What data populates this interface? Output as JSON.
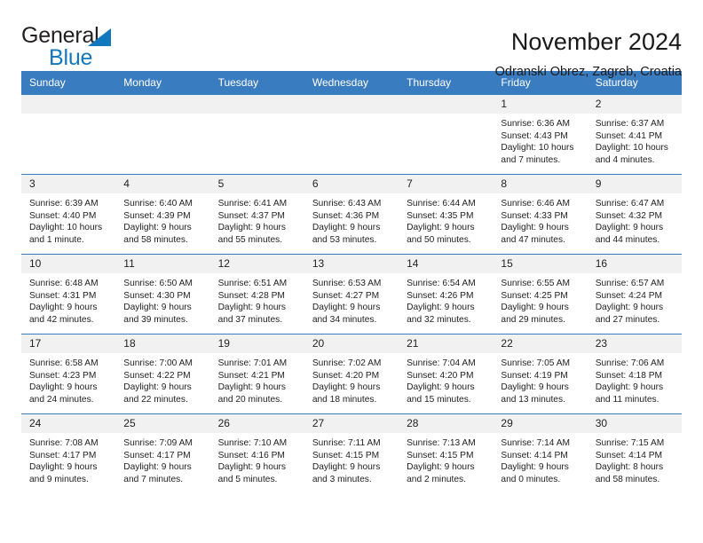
{
  "brand": {
    "word_one": "General",
    "word_two": "Blue",
    "triangle_color": "#1278be"
  },
  "header": {
    "title": "November 2024",
    "subtitle": "Odranski Obrez, Zagreb, Croatia",
    "accent_color": "#3a7cc0",
    "daynum_bg": "#f1f1f1"
  },
  "weekday_headers": [
    "Sunday",
    "Monday",
    "Tuesday",
    "Wednesday",
    "Thursday",
    "Friday",
    "Saturday"
  ],
  "labels": {
    "sunrise": "Sunrise:",
    "sunset": "Sunset:",
    "daylight": "Daylight:"
  },
  "weeks": [
    [
      {
        "day": "",
        "empty": true
      },
      {
        "day": "",
        "empty": true
      },
      {
        "day": "",
        "empty": true
      },
      {
        "day": "",
        "empty": true
      },
      {
        "day": "",
        "empty": true
      },
      {
        "day": "1",
        "sunrise": "Sunrise: 6:36 AM",
        "sunset": "Sunset: 4:43 PM",
        "daylight_1": "Daylight: 10 hours",
        "daylight_2": "and 7 minutes."
      },
      {
        "day": "2",
        "sunrise": "Sunrise: 6:37 AM",
        "sunset": "Sunset: 4:41 PM",
        "daylight_1": "Daylight: 10 hours",
        "daylight_2": "and 4 minutes."
      }
    ],
    [
      {
        "day": "3",
        "sunrise": "Sunrise: 6:39 AM",
        "sunset": "Sunset: 4:40 PM",
        "daylight_1": "Daylight: 10 hours",
        "daylight_2": "and 1 minute."
      },
      {
        "day": "4",
        "sunrise": "Sunrise: 6:40 AM",
        "sunset": "Sunset: 4:39 PM",
        "daylight_1": "Daylight: 9 hours",
        "daylight_2": "and 58 minutes."
      },
      {
        "day": "5",
        "sunrise": "Sunrise: 6:41 AM",
        "sunset": "Sunset: 4:37 PM",
        "daylight_1": "Daylight: 9 hours",
        "daylight_2": "and 55 minutes."
      },
      {
        "day": "6",
        "sunrise": "Sunrise: 6:43 AM",
        "sunset": "Sunset: 4:36 PM",
        "daylight_1": "Daylight: 9 hours",
        "daylight_2": "and 53 minutes."
      },
      {
        "day": "7",
        "sunrise": "Sunrise: 6:44 AM",
        "sunset": "Sunset: 4:35 PM",
        "daylight_1": "Daylight: 9 hours",
        "daylight_2": "and 50 minutes."
      },
      {
        "day": "8",
        "sunrise": "Sunrise: 6:46 AM",
        "sunset": "Sunset: 4:33 PM",
        "daylight_1": "Daylight: 9 hours",
        "daylight_2": "and 47 minutes."
      },
      {
        "day": "9",
        "sunrise": "Sunrise: 6:47 AM",
        "sunset": "Sunset: 4:32 PM",
        "daylight_1": "Daylight: 9 hours",
        "daylight_2": "and 44 minutes."
      }
    ],
    [
      {
        "day": "10",
        "sunrise": "Sunrise: 6:48 AM",
        "sunset": "Sunset: 4:31 PM",
        "daylight_1": "Daylight: 9 hours",
        "daylight_2": "and 42 minutes."
      },
      {
        "day": "11",
        "sunrise": "Sunrise: 6:50 AM",
        "sunset": "Sunset: 4:30 PM",
        "daylight_1": "Daylight: 9 hours",
        "daylight_2": "and 39 minutes."
      },
      {
        "day": "12",
        "sunrise": "Sunrise: 6:51 AM",
        "sunset": "Sunset: 4:28 PM",
        "daylight_1": "Daylight: 9 hours",
        "daylight_2": "and 37 minutes."
      },
      {
        "day": "13",
        "sunrise": "Sunrise: 6:53 AM",
        "sunset": "Sunset: 4:27 PM",
        "daylight_1": "Daylight: 9 hours",
        "daylight_2": "and 34 minutes."
      },
      {
        "day": "14",
        "sunrise": "Sunrise: 6:54 AM",
        "sunset": "Sunset: 4:26 PM",
        "daylight_1": "Daylight: 9 hours",
        "daylight_2": "and 32 minutes."
      },
      {
        "day": "15",
        "sunrise": "Sunrise: 6:55 AM",
        "sunset": "Sunset: 4:25 PM",
        "daylight_1": "Daylight: 9 hours",
        "daylight_2": "and 29 minutes."
      },
      {
        "day": "16",
        "sunrise": "Sunrise: 6:57 AM",
        "sunset": "Sunset: 4:24 PM",
        "daylight_1": "Daylight: 9 hours",
        "daylight_2": "and 27 minutes."
      }
    ],
    [
      {
        "day": "17",
        "sunrise": "Sunrise: 6:58 AM",
        "sunset": "Sunset: 4:23 PM",
        "daylight_1": "Daylight: 9 hours",
        "daylight_2": "and 24 minutes."
      },
      {
        "day": "18",
        "sunrise": "Sunrise: 7:00 AM",
        "sunset": "Sunset: 4:22 PM",
        "daylight_1": "Daylight: 9 hours",
        "daylight_2": "and 22 minutes."
      },
      {
        "day": "19",
        "sunrise": "Sunrise: 7:01 AM",
        "sunset": "Sunset: 4:21 PM",
        "daylight_1": "Daylight: 9 hours",
        "daylight_2": "and 20 minutes."
      },
      {
        "day": "20",
        "sunrise": "Sunrise: 7:02 AM",
        "sunset": "Sunset: 4:20 PM",
        "daylight_1": "Daylight: 9 hours",
        "daylight_2": "and 18 minutes."
      },
      {
        "day": "21",
        "sunrise": "Sunrise: 7:04 AM",
        "sunset": "Sunset: 4:20 PM",
        "daylight_1": "Daylight: 9 hours",
        "daylight_2": "and 15 minutes."
      },
      {
        "day": "22",
        "sunrise": "Sunrise: 7:05 AM",
        "sunset": "Sunset: 4:19 PM",
        "daylight_1": "Daylight: 9 hours",
        "daylight_2": "and 13 minutes."
      },
      {
        "day": "23",
        "sunrise": "Sunrise: 7:06 AM",
        "sunset": "Sunset: 4:18 PM",
        "daylight_1": "Daylight: 9 hours",
        "daylight_2": "and 11 minutes."
      }
    ],
    [
      {
        "day": "24",
        "sunrise": "Sunrise: 7:08 AM",
        "sunset": "Sunset: 4:17 PM",
        "daylight_1": "Daylight: 9 hours",
        "daylight_2": "and 9 minutes."
      },
      {
        "day": "25",
        "sunrise": "Sunrise: 7:09 AM",
        "sunset": "Sunset: 4:17 PM",
        "daylight_1": "Daylight: 9 hours",
        "daylight_2": "and 7 minutes."
      },
      {
        "day": "26",
        "sunrise": "Sunrise: 7:10 AM",
        "sunset": "Sunset: 4:16 PM",
        "daylight_1": "Daylight: 9 hours",
        "daylight_2": "and 5 minutes."
      },
      {
        "day": "27",
        "sunrise": "Sunrise: 7:11 AM",
        "sunset": "Sunset: 4:15 PM",
        "daylight_1": "Daylight: 9 hours",
        "daylight_2": "and 3 minutes."
      },
      {
        "day": "28",
        "sunrise": "Sunrise: 7:13 AM",
        "sunset": "Sunset: 4:15 PM",
        "daylight_1": "Daylight: 9 hours",
        "daylight_2": "and 2 minutes."
      },
      {
        "day": "29",
        "sunrise": "Sunrise: 7:14 AM",
        "sunset": "Sunset: 4:14 PM",
        "daylight_1": "Daylight: 9 hours",
        "daylight_2": "and 0 minutes."
      },
      {
        "day": "30",
        "sunrise": "Sunrise: 7:15 AM",
        "sunset": "Sunset: 4:14 PM",
        "daylight_1": "Daylight: 8 hours",
        "daylight_2": "and 58 minutes."
      }
    ]
  ]
}
